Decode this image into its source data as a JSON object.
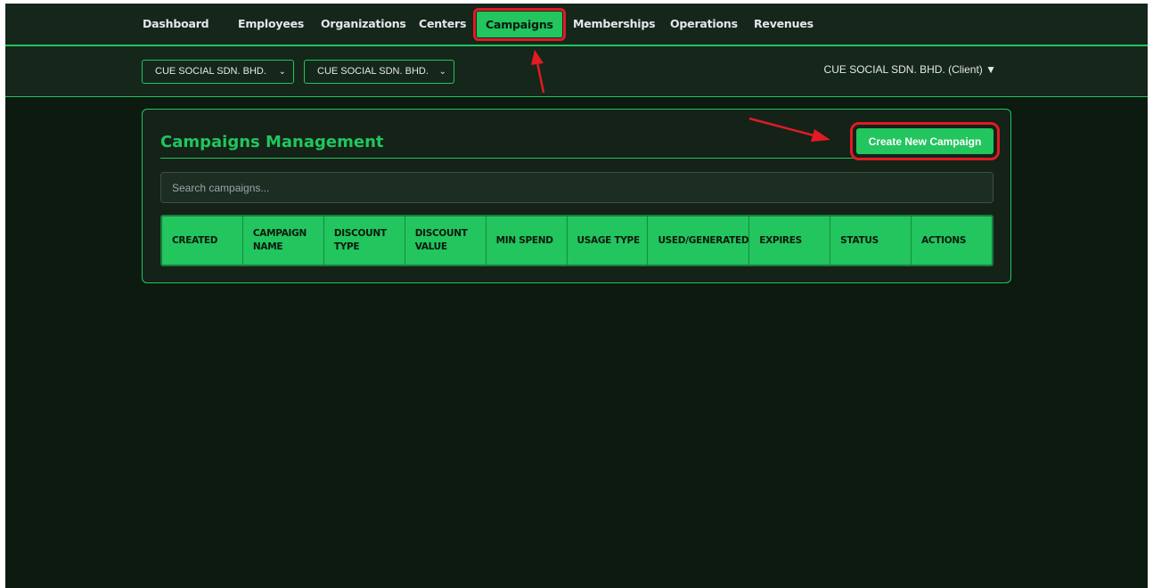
{
  "nav": {
    "items": [
      {
        "label": "Dashboard"
      },
      {
        "label": "Employees"
      },
      {
        "label": "Organizations"
      },
      {
        "label": "Centers"
      },
      {
        "label": "Campaigns",
        "active": true
      },
      {
        "label": "Memberships"
      },
      {
        "label": "Operations"
      },
      {
        "label": "Revenues"
      }
    ]
  },
  "filters": {
    "organization_select": "CUE SOCIAL SDN. BHD.",
    "center_select": "CUE SOCIAL SDN. BHD.",
    "client_label": "CUE SOCIAL SDN. BHD. (Client) ▼"
  },
  "campaigns": {
    "title": "Campaigns Management",
    "create_button": "Create New Campaign",
    "search_placeholder": "Search campaigns...",
    "columns": [
      "CREATED",
      "CAMPAIGN\nNAME",
      "DISCOUNT\nTYPE",
      "DISCOUNT\nVALUE",
      "MIN SPEND",
      "USAGE TYPE",
      "USED/GENERATED",
      "EXPIRES",
      "STATUS",
      "ACTIONS"
    ]
  },
  "colors": {
    "accent": "#22c55e",
    "background": "#0c1a0f",
    "annotation": "#e01b24"
  }
}
